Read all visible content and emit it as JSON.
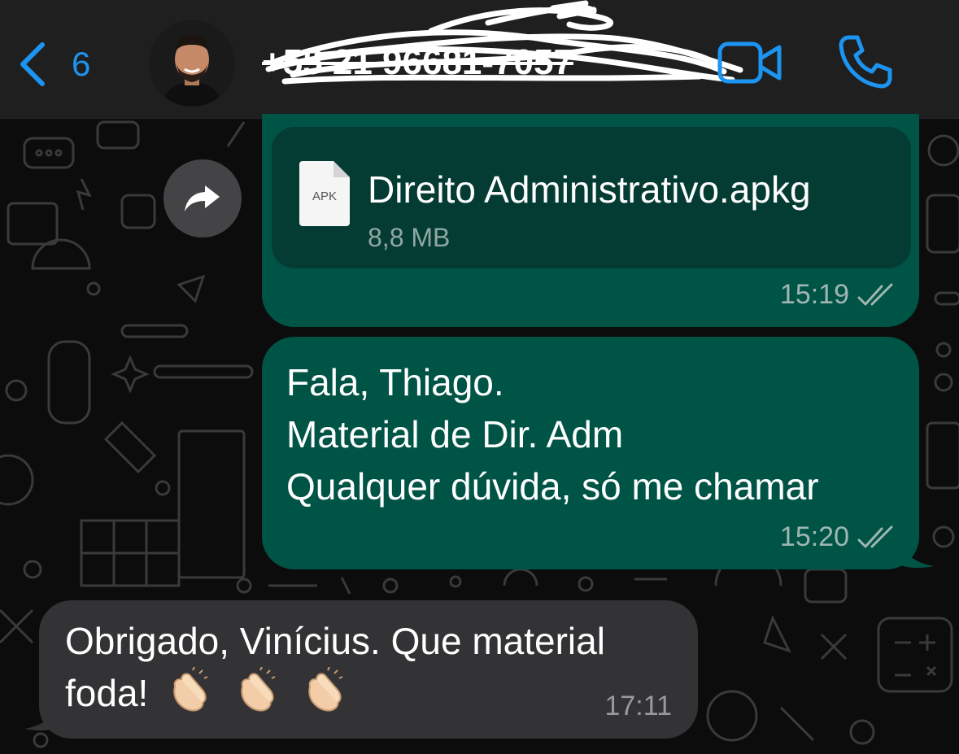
{
  "header": {
    "back_count": "6",
    "contact_name": "+55 21 96681-7057"
  },
  "messages": [
    {
      "type": "document",
      "direction": "outgoing",
      "file_type_label": "APK",
      "file_name": "Direito Administrativo.apkg",
      "file_size": "8,8 MB",
      "time": "15:19",
      "status": "read"
    },
    {
      "type": "text",
      "direction": "outgoing",
      "lines": [
        "Fala, Thiago.",
        "Material de Dir. Adm",
        "Qualquer dúvida, só me chamar"
      ],
      "time": "15:20",
      "status": "read"
    },
    {
      "type": "text",
      "direction": "incoming",
      "line1": "Obrigado, Vinícius. Que material",
      "line2": "foda!",
      "emoji": "clapping-hands x3",
      "time": "17:11"
    }
  ],
  "colors": {
    "accent": "#1c94f1",
    "outgoing_bubble": "#005446",
    "document_card": "#043c33",
    "incoming_bubble": "#333335",
    "header_bg": "#1f1f1f"
  }
}
